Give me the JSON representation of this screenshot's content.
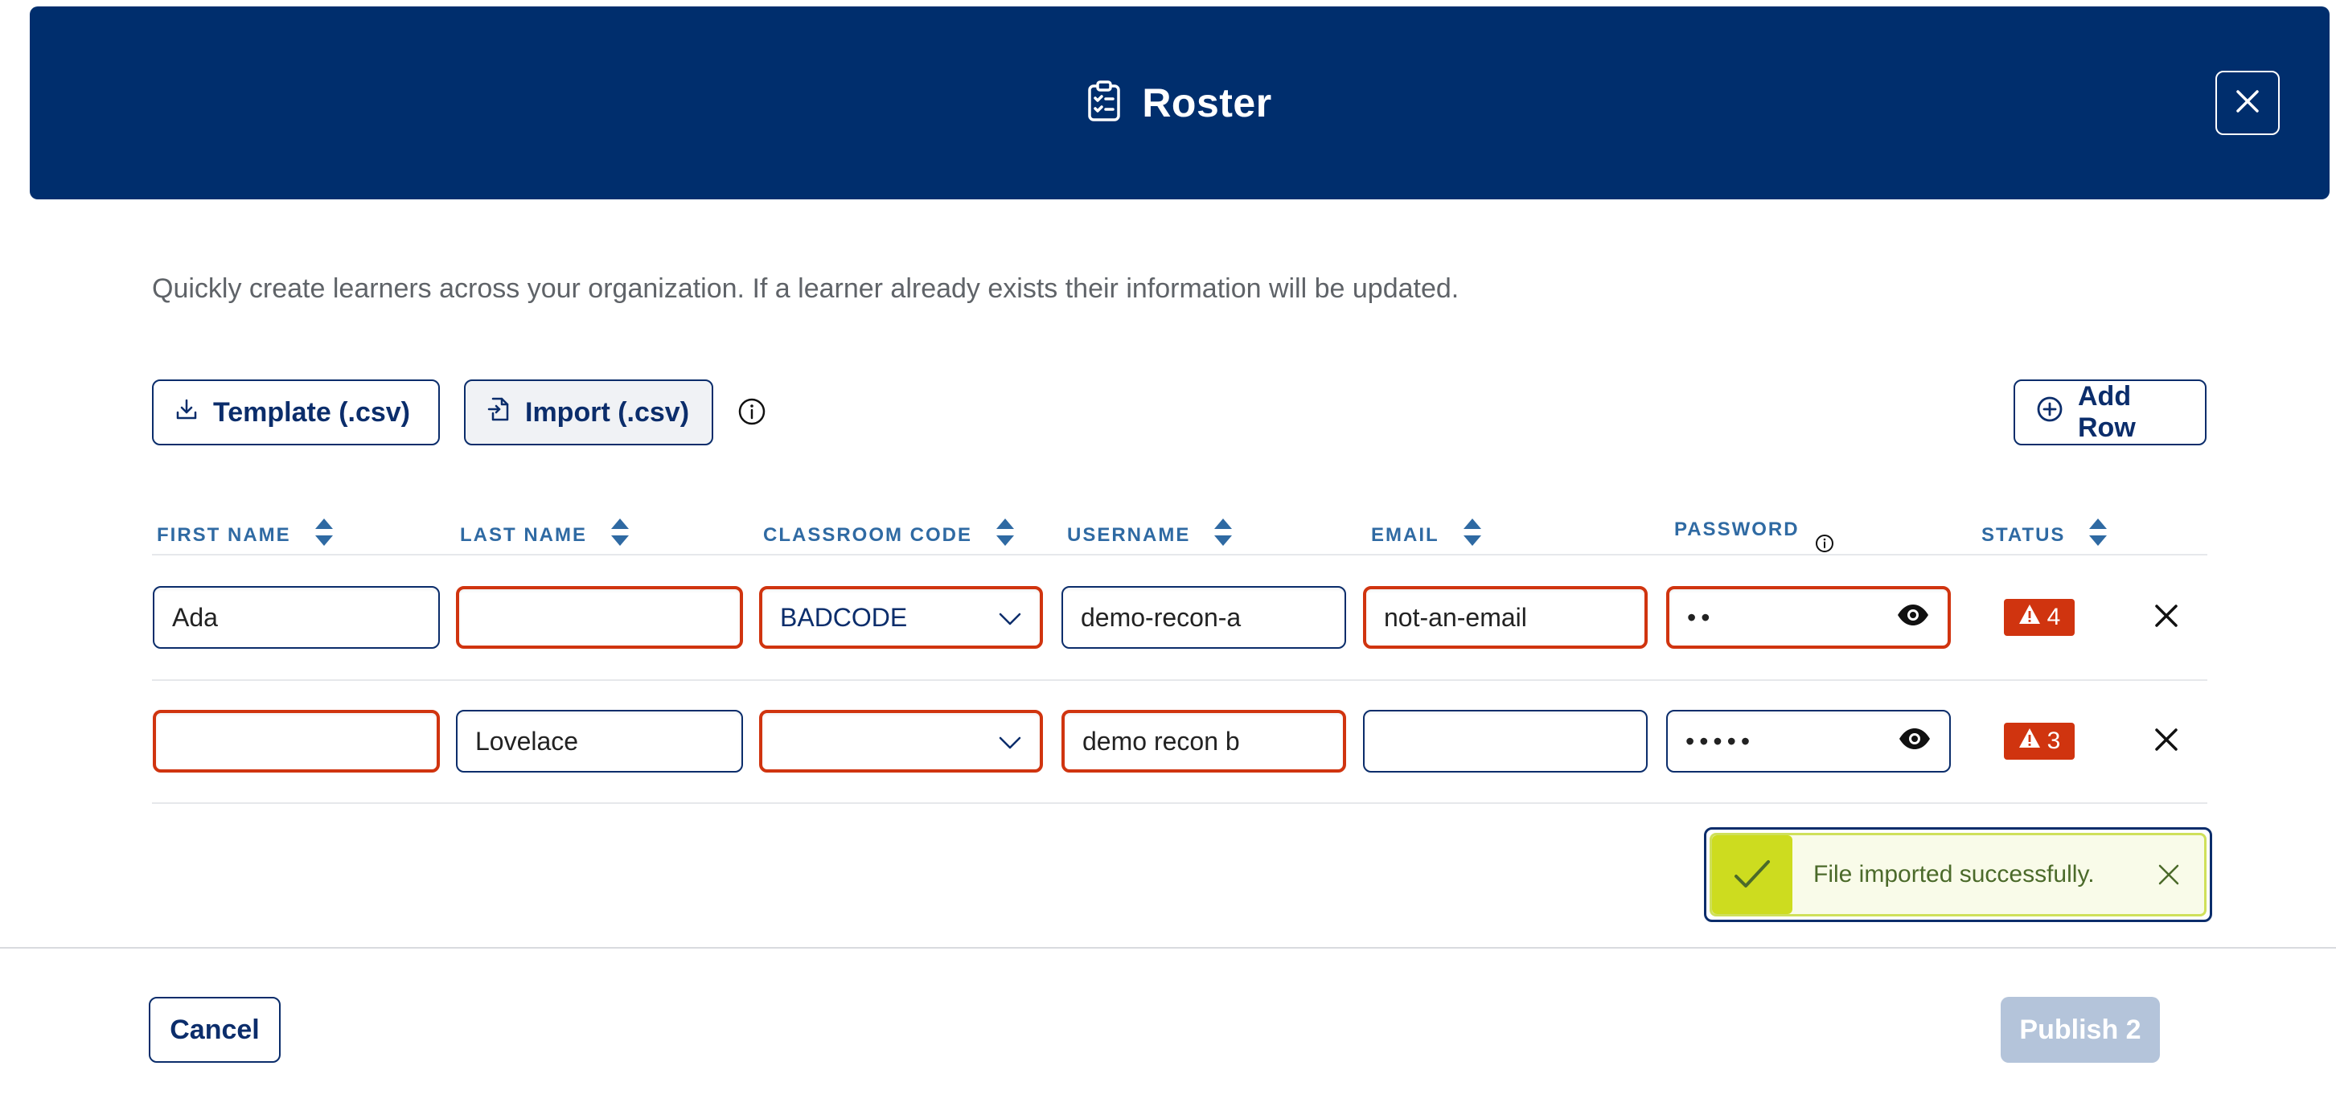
{
  "header": {
    "title": "Roster",
    "icon": "clipboard-list-icon",
    "close_icon": "close-icon"
  },
  "description": "Quickly create learners across your organization. If a learner already exists their information will be updated.",
  "toolbar": {
    "template_label": "Template (.csv)",
    "import_label": "Import (.csv)",
    "add_row_label": "Add Row"
  },
  "columns": [
    {
      "label": "FIRST NAME",
      "sortable": true
    },
    {
      "label": "LAST NAME",
      "sortable": true
    },
    {
      "label": "CLASSROOM CODE",
      "sortable": true
    },
    {
      "label": "USERNAME",
      "sortable": true
    },
    {
      "label": "EMAIL",
      "sortable": true
    },
    {
      "label": "PASSWORD",
      "sortable": false
    },
    {
      "label": "STATUS",
      "sortable": true
    }
  ],
  "rows": [
    {
      "first_name": "Ada",
      "last_name": "",
      "classroom_code": "BADCODE",
      "username": "demo-recon-a",
      "email": "not-an-email",
      "password": "••",
      "status_count": "4"
    },
    {
      "first_name": "",
      "last_name": "Lovelace",
      "classroom_code": "",
      "username": "demo recon b",
      "email": "",
      "password": "•••••",
      "status_count": "3"
    }
  ],
  "toast": {
    "message": "File imported successfully."
  },
  "footer": {
    "cancel_label": "Cancel",
    "publish_label": "Publish 2"
  },
  "colors": {
    "primary": "#002e6d",
    "error": "#d0340f",
    "success": "#cddc1f",
    "disabled": "#b4c4da"
  }
}
